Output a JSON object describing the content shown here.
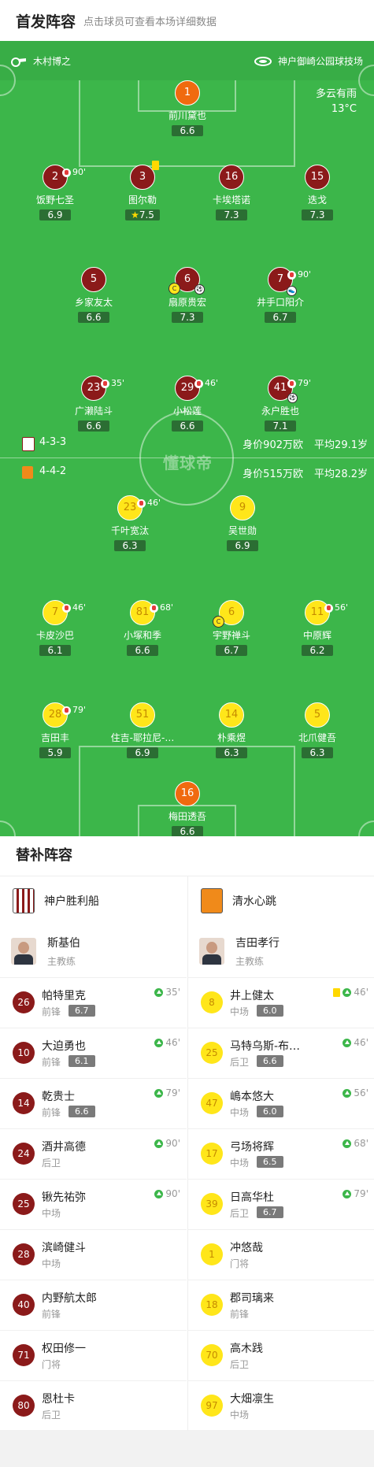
{
  "header": {
    "title": "首发阵容",
    "subtitle": "点击球员可查看本场详细数据"
  },
  "match": {
    "referee": "木村博之",
    "stadium": "神户御崎公园球技场",
    "weather": "多云有雨",
    "temperature": "13°C"
  },
  "watermark": "懂球帝",
  "home": {
    "formation": "4-3-3",
    "value": "身价902万欧",
    "avg_age": "平均29.1岁",
    "players": [
      {
        "num": "1",
        "name": "前川黛也",
        "rating": "6.6"
      },
      {
        "num": "2",
        "name": "饭野七圣",
        "rating": "6.9",
        "sub": "90'"
      },
      {
        "num": "3",
        "name": "图尔勒",
        "rating": "7.5",
        "star": true
      },
      {
        "num": "16",
        "name": "卡埃塔诺",
        "rating": "7.3"
      },
      {
        "num": "15",
        "name": "迭戈",
        "rating": "7.3"
      },
      {
        "num": "5",
        "name": "乡家友太",
        "rating": "6.6"
      },
      {
        "num": "6",
        "name": "扇原贵宏",
        "rating": "7.3"
      },
      {
        "num": "7",
        "name": "井手口阳介",
        "rating": "6.7",
        "sub": "90'"
      },
      {
        "num": "23",
        "name": "广濑陆斗",
        "rating": "6.6",
        "sub": "35'"
      },
      {
        "num": "29",
        "name": "小松莲",
        "rating": "6.6",
        "sub": "46'"
      },
      {
        "num": "41",
        "name": "永户胜也",
        "rating": "7.1",
        "sub": "79'"
      }
    ]
  },
  "away": {
    "formation": "4-4-2",
    "value": "身价515万欧",
    "avg_age": "平均28.2岁",
    "players": [
      {
        "num": "23",
        "name": "千叶宽汰",
        "rating": "6.3",
        "sub": "46'"
      },
      {
        "num": "9",
        "name": "吴世勋",
        "rating": "6.9"
      },
      {
        "num": "7",
        "name": "卡皮沙巴",
        "rating": "6.1",
        "sub": "46'"
      },
      {
        "num": "81",
        "name": "小塚和季",
        "rating": "6.6",
        "sub": "68'"
      },
      {
        "num": "6",
        "name": "宇野禅斗",
        "rating": "6.7"
      },
      {
        "num": "11",
        "name": "中原辉",
        "rating": "6.2",
        "sub": "56'"
      },
      {
        "num": "28",
        "name": "吉田丰",
        "rating": "5.9",
        "sub": "79'"
      },
      {
        "num": "51",
        "name": "住吉-耶拉尼-…",
        "rating": "6.9"
      },
      {
        "num": "14",
        "name": "朴乘煜",
        "rating": "6.3"
      },
      {
        "num": "5",
        "name": "北爪健吾",
        "rating": "6.3"
      },
      {
        "num": "16",
        "name": "梅田透吾",
        "rating": "6.6"
      }
    ]
  },
  "subs": {
    "title": "替补阵容",
    "home": {
      "team": "神户胜利船",
      "coach": {
        "name": "斯基伯",
        "role": "主教练"
      },
      "players": [
        {
          "num": "26",
          "name": "帕特里克",
          "pos": "前锋",
          "rating": "6.7",
          "min": "35'"
        },
        {
          "num": "10",
          "name": "大迫勇也",
          "pos": "前锋",
          "rating": "6.1",
          "min": "46'"
        },
        {
          "num": "14",
          "name": "乾贵士",
          "pos": "前锋",
          "rating": "6.6",
          "min": "79'"
        },
        {
          "num": "24",
          "name": "酒井高德",
          "pos": "后卫",
          "rating": "",
          "min": "90'"
        },
        {
          "num": "25",
          "name": "锹先祐弥",
          "pos": "中场",
          "rating": "",
          "min": "90'"
        },
        {
          "num": "28",
          "name": "滨崎健斗",
          "pos": "中场",
          "rating": "",
          "min": ""
        },
        {
          "num": "40",
          "name": "内野航太郎",
          "pos": "前锋",
          "rating": "",
          "min": ""
        },
        {
          "num": "71",
          "name": "权田修一",
          "pos": "门将",
          "rating": "",
          "min": ""
        },
        {
          "num": "80",
          "name": "恩杜卡",
          "pos": "后卫",
          "rating": "",
          "min": ""
        }
      ]
    },
    "away": {
      "team": "清水心跳",
      "coach": {
        "name": "吉田孝行",
        "role": "主教练"
      },
      "players": [
        {
          "num": "8",
          "name": "井上健太",
          "pos": "中场",
          "rating": "6.0",
          "min": "46'",
          "card": true
        },
        {
          "num": "25",
          "name": "马特乌斯-布…",
          "pos": "后卫",
          "rating": "6.6",
          "min": "46'"
        },
        {
          "num": "47",
          "name": "嶋本悠大",
          "pos": "中场",
          "rating": "6.0",
          "min": "56'"
        },
        {
          "num": "17",
          "name": "弓场将辉",
          "pos": "中场",
          "rating": "6.5",
          "min": "68'"
        },
        {
          "num": "39",
          "name": "日高华杜",
          "pos": "后卫",
          "rating": "6.7",
          "min": "79'"
        },
        {
          "num": "1",
          "name": "冲悠哉",
          "pos": "门将",
          "rating": "",
          "min": ""
        },
        {
          "num": "18",
          "name": "郡司璃来",
          "pos": "前锋",
          "rating": "",
          "min": ""
        },
        {
          "num": "70",
          "name": "高木践",
          "pos": "后卫",
          "rating": "",
          "min": ""
        },
        {
          "num": "97",
          "name": "大畑凛生",
          "pos": "中场",
          "rating": "",
          "min": ""
        }
      ]
    }
  }
}
